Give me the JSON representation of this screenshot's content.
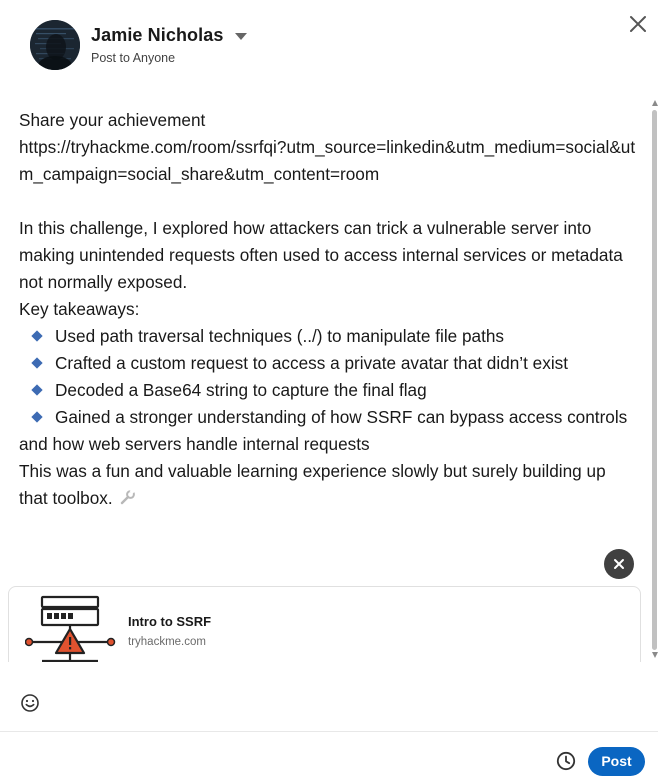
{
  "header": {
    "author_name": "Jamie Nicholas",
    "audience": "Post to Anyone"
  },
  "post": {
    "lines": [
      "Share your achievement",
      "https://tryhackme.com/room/ssrfqi?utm_source=linkedin&utm_medium=social&utm_campaign=social_share&utm_content=room",
      "",
      "In this challenge, I explored how attackers can trick a vulnerable server into making unintended requests often used to access internal services or metadata not normally exposed.",
      "Key takeaways:"
    ],
    "bullets": [
      "Used path traversal techniques (../) to manipulate file paths",
      "Crafted a custom request to access a private avatar that didn’t exist",
      "Decoded a Base64 string to capture the final flag",
      "Gained a stronger understanding of how SSRF can bypass access controls and how web servers handle internal requests"
    ],
    "closing": "This was a fun and valuable learning experience slowly but surely building up that toolbox."
  },
  "link_preview": {
    "title": "Intro to SSRF",
    "domain": "tryhackme.com"
  },
  "footer": {
    "post_label": "Post"
  },
  "icons": {
    "close": "close-icon",
    "caret": "caret-down-icon",
    "dismiss": "dismiss-preview-icon",
    "emoji": "emoji-icon",
    "schedule": "clock-icon",
    "wrench": "wrench-icon"
  },
  "colors": {
    "accent": "#0a66c2",
    "bullet": "#3d6bb3",
    "dismiss_bg": "#404040"
  }
}
